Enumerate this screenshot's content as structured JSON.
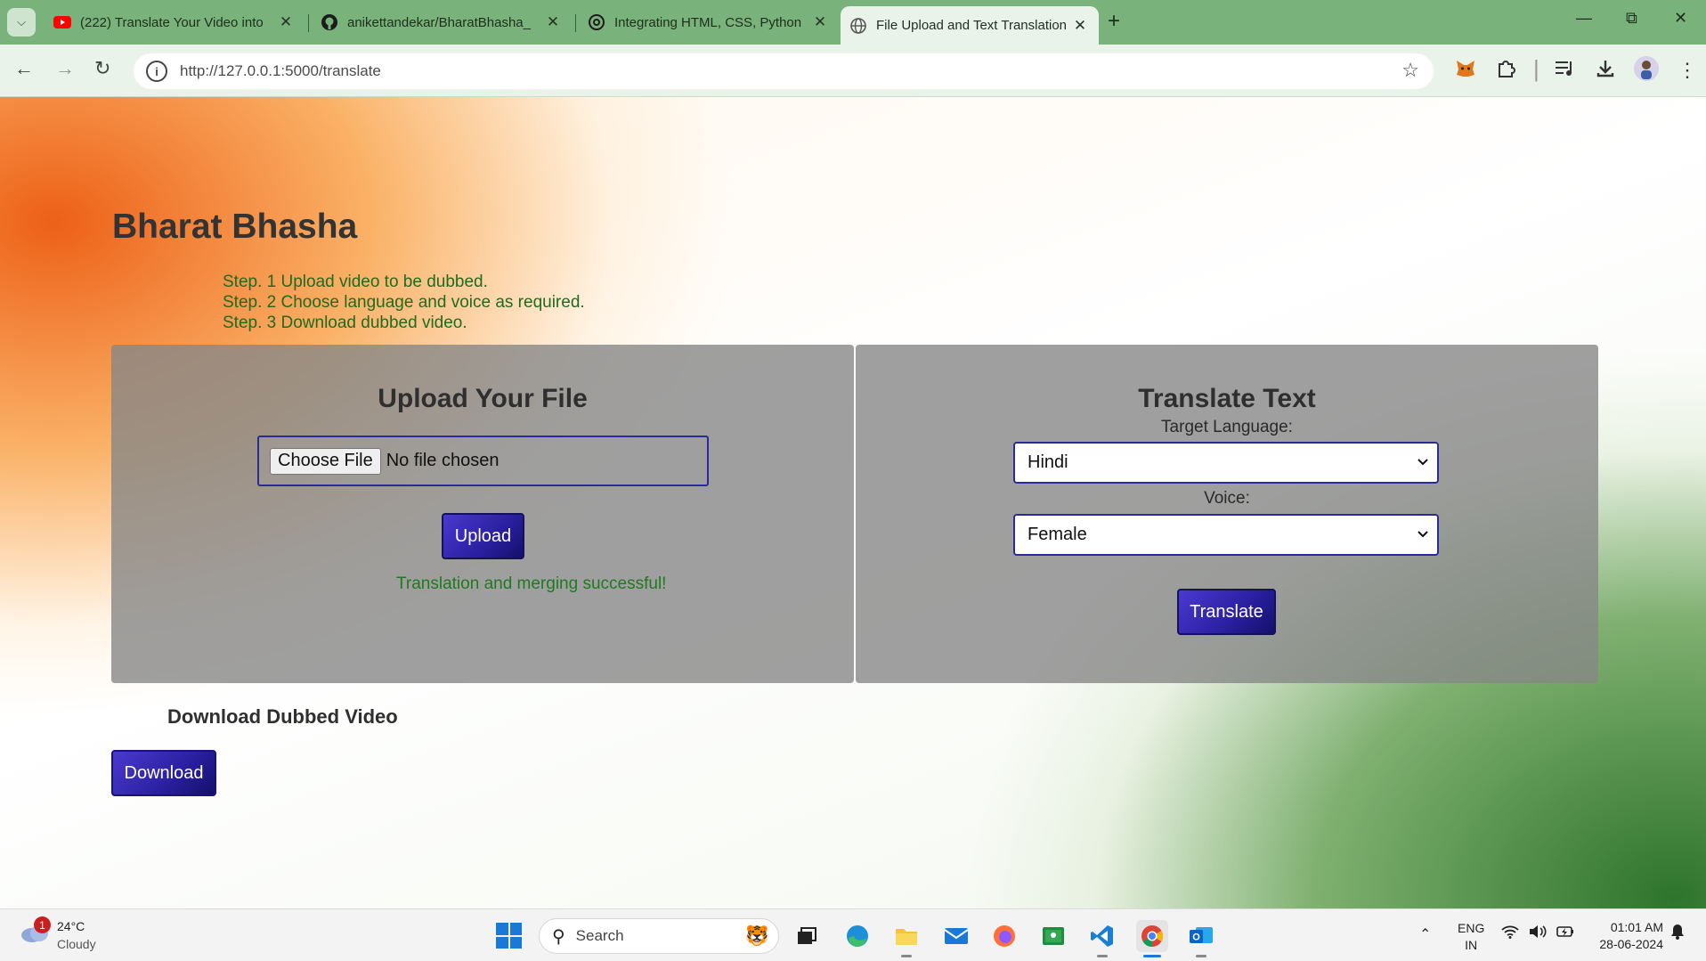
{
  "browser": {
    "tabs": [
      {
        "title": "(222) Translate Your Video into",
        "favicon": "youtube-icon",
        "active": false
      },
      {
        "title": "anikettandekar/BharatBhasha_",
        "favicon": "github-icon",
        "active": false
      },
      {
        "title": "Integrating HTML, CSS, Python",
        "favicon": "chatgpt-icon",
        "active": false
      },
      {
        "title": "File Upload and Text Translation",
        "favicon": "globe-icon",
        "active": true
      }
    ],
    "url": "http://127.0.0.1:5000/translate",
    "colors": {
      "tabbar": "#79b27a",
      "toolbar": "#eaf3ea"
    }
  },
  "page": {
    "site_title": "Bharat Bhasha",
    "steps": [
      "Step. 1 Upload video to be dubbed.",
      "Step. 2 Choose language and voice as required.",
      "Step. 3 Download dubbed video."
    ],
    "upload_panel": {
      "title": "Upload Your File",
      "choose_file_label": "Choose File",
      "file_status": "No file chosen",
      "upload_button": "Upload",
      "success_message": "Translation and merging successful!"
    },
    "translate_panel": {
      "title": "Translate Text",
      "target_language_label": "Target Language:",
      "target_language_value": "Hindi",
      "voice_label": "Voice:",
      "voice_value": "Female",
      "translate_button": "Translate"
    },
    "download": {
      "heading": "Download Dubbed Video",
      "button": "Download"
    },
    "colors": {
      "accent": "#2a1fa0",
      "success": "#1f7a1f",
      "saffron": "#ec580c",
      "green": "#287026"
    }
  },
  "taskbar": {
    "weather_badge": "1",
    "weather_temp": "24°C",
    "weather_desc": "Cloudy",
    "search_placeholder": "Search",
    "lang_line1": "ENG",
    "lang_line2": "IN",
    "time": "01:01 AM",
    "date": "28-06-2024"
  }
}
